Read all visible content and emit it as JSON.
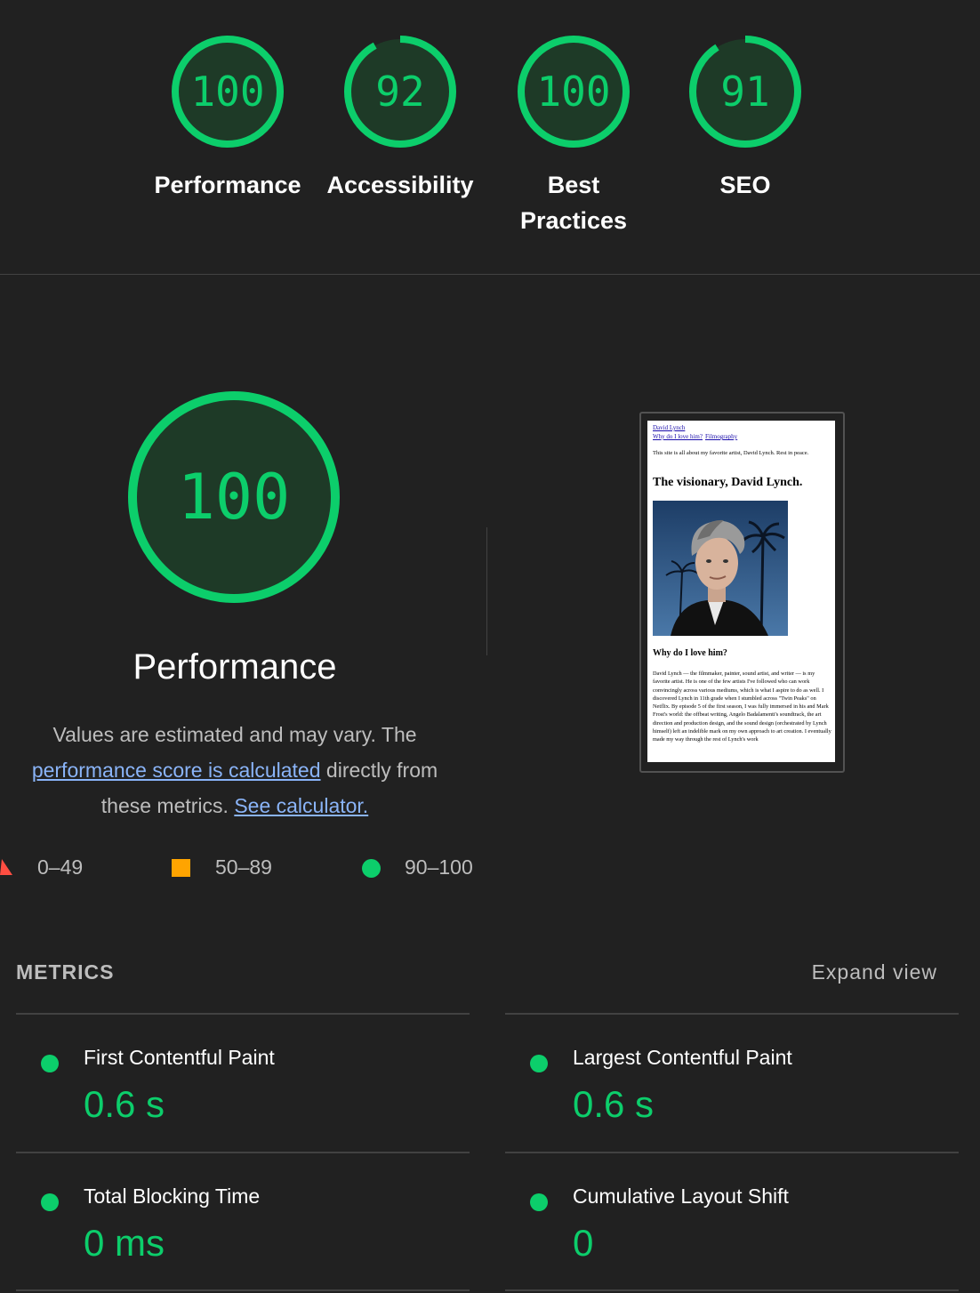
{
  "colors": {
    "pass": "#0cce6b",
    "average": "#ffa400",
    "fail": "#ff4e42",
    "link": "#8ab4f8"
  },
  "categories": [
    {
      "label": "Performance",
      "score": 100
    },
    {
      "label": "Accessibility",
      "score": 92
    },
    {
      "label": "Best Practices",
      "score": 100
    },
    {
      "label": "SEO",
      "score": 91
    }
  ],
  "performance": {
    "score": 100,
    "title": "Performance",
    "desc_part1": "Values are estimated and may vary. The",
    "desc_link": "performance score is calculated",
    "desc_part2": "directly from",
    "desc_part3": "these metrics.",
    "calculator_link": "See calculator."
  },
  "legend": [
    {
      "icon": "triangle-icon",
      "range": "0–49"
    },
    {
      "icon": "square-icon",
      "range": "50–89"
    },
    {
      "icon": "circle-icon",
      "range": "90–100"
    }
  ],
  "screenshot": {
    "nav_home": "David Lynch",
    "nav_links": [
      "Why do I love him?",
      "Filmography"
    ],
    "intro": "This site is all about my favorite artist, David Lynch. Rest in peace.",
    "heading": "The visionary, David Lynch.",
    "subheading": "Why do I love him?",
    "body": "David Lynch — the filmmaker, painter, sound artist, and writer — is my favorite artist. He is one of the few artists I've followed who can work convincingly across various mediums, which is what I aspire to do as well. I discovered Lynch in 11th grade when I stumbled across \"Twin Peaks\" on Netflix. By episode 5 of the first season, I was fully immersed in his and Mark Frost's world: the offbeat writing, Angelo Badalamenti's soundtrack, the art direction and production design, and the sound design (orchestrated by Lynch himself) left an indelible mark on my own approach to art creation. I eventually made my way through the rest of Lynch's work"
  },
  "metrics": {
    "heading": "METRICS",
    "expand_label": "Expand view",
    "items": [
      {
        "title": "First Contentful Paint",
        "value": "0.6 s"
      },
      {
        "title": "Largest Contentful Paint",
        "value": "0.6 s"
      },
      {
        "title": "Total Blocking Time",
        "value": "0 ms"
      },
      {
        "title": "Cumulative Layout Shift",
        "value": "0"
      }
    ]
  }
}
